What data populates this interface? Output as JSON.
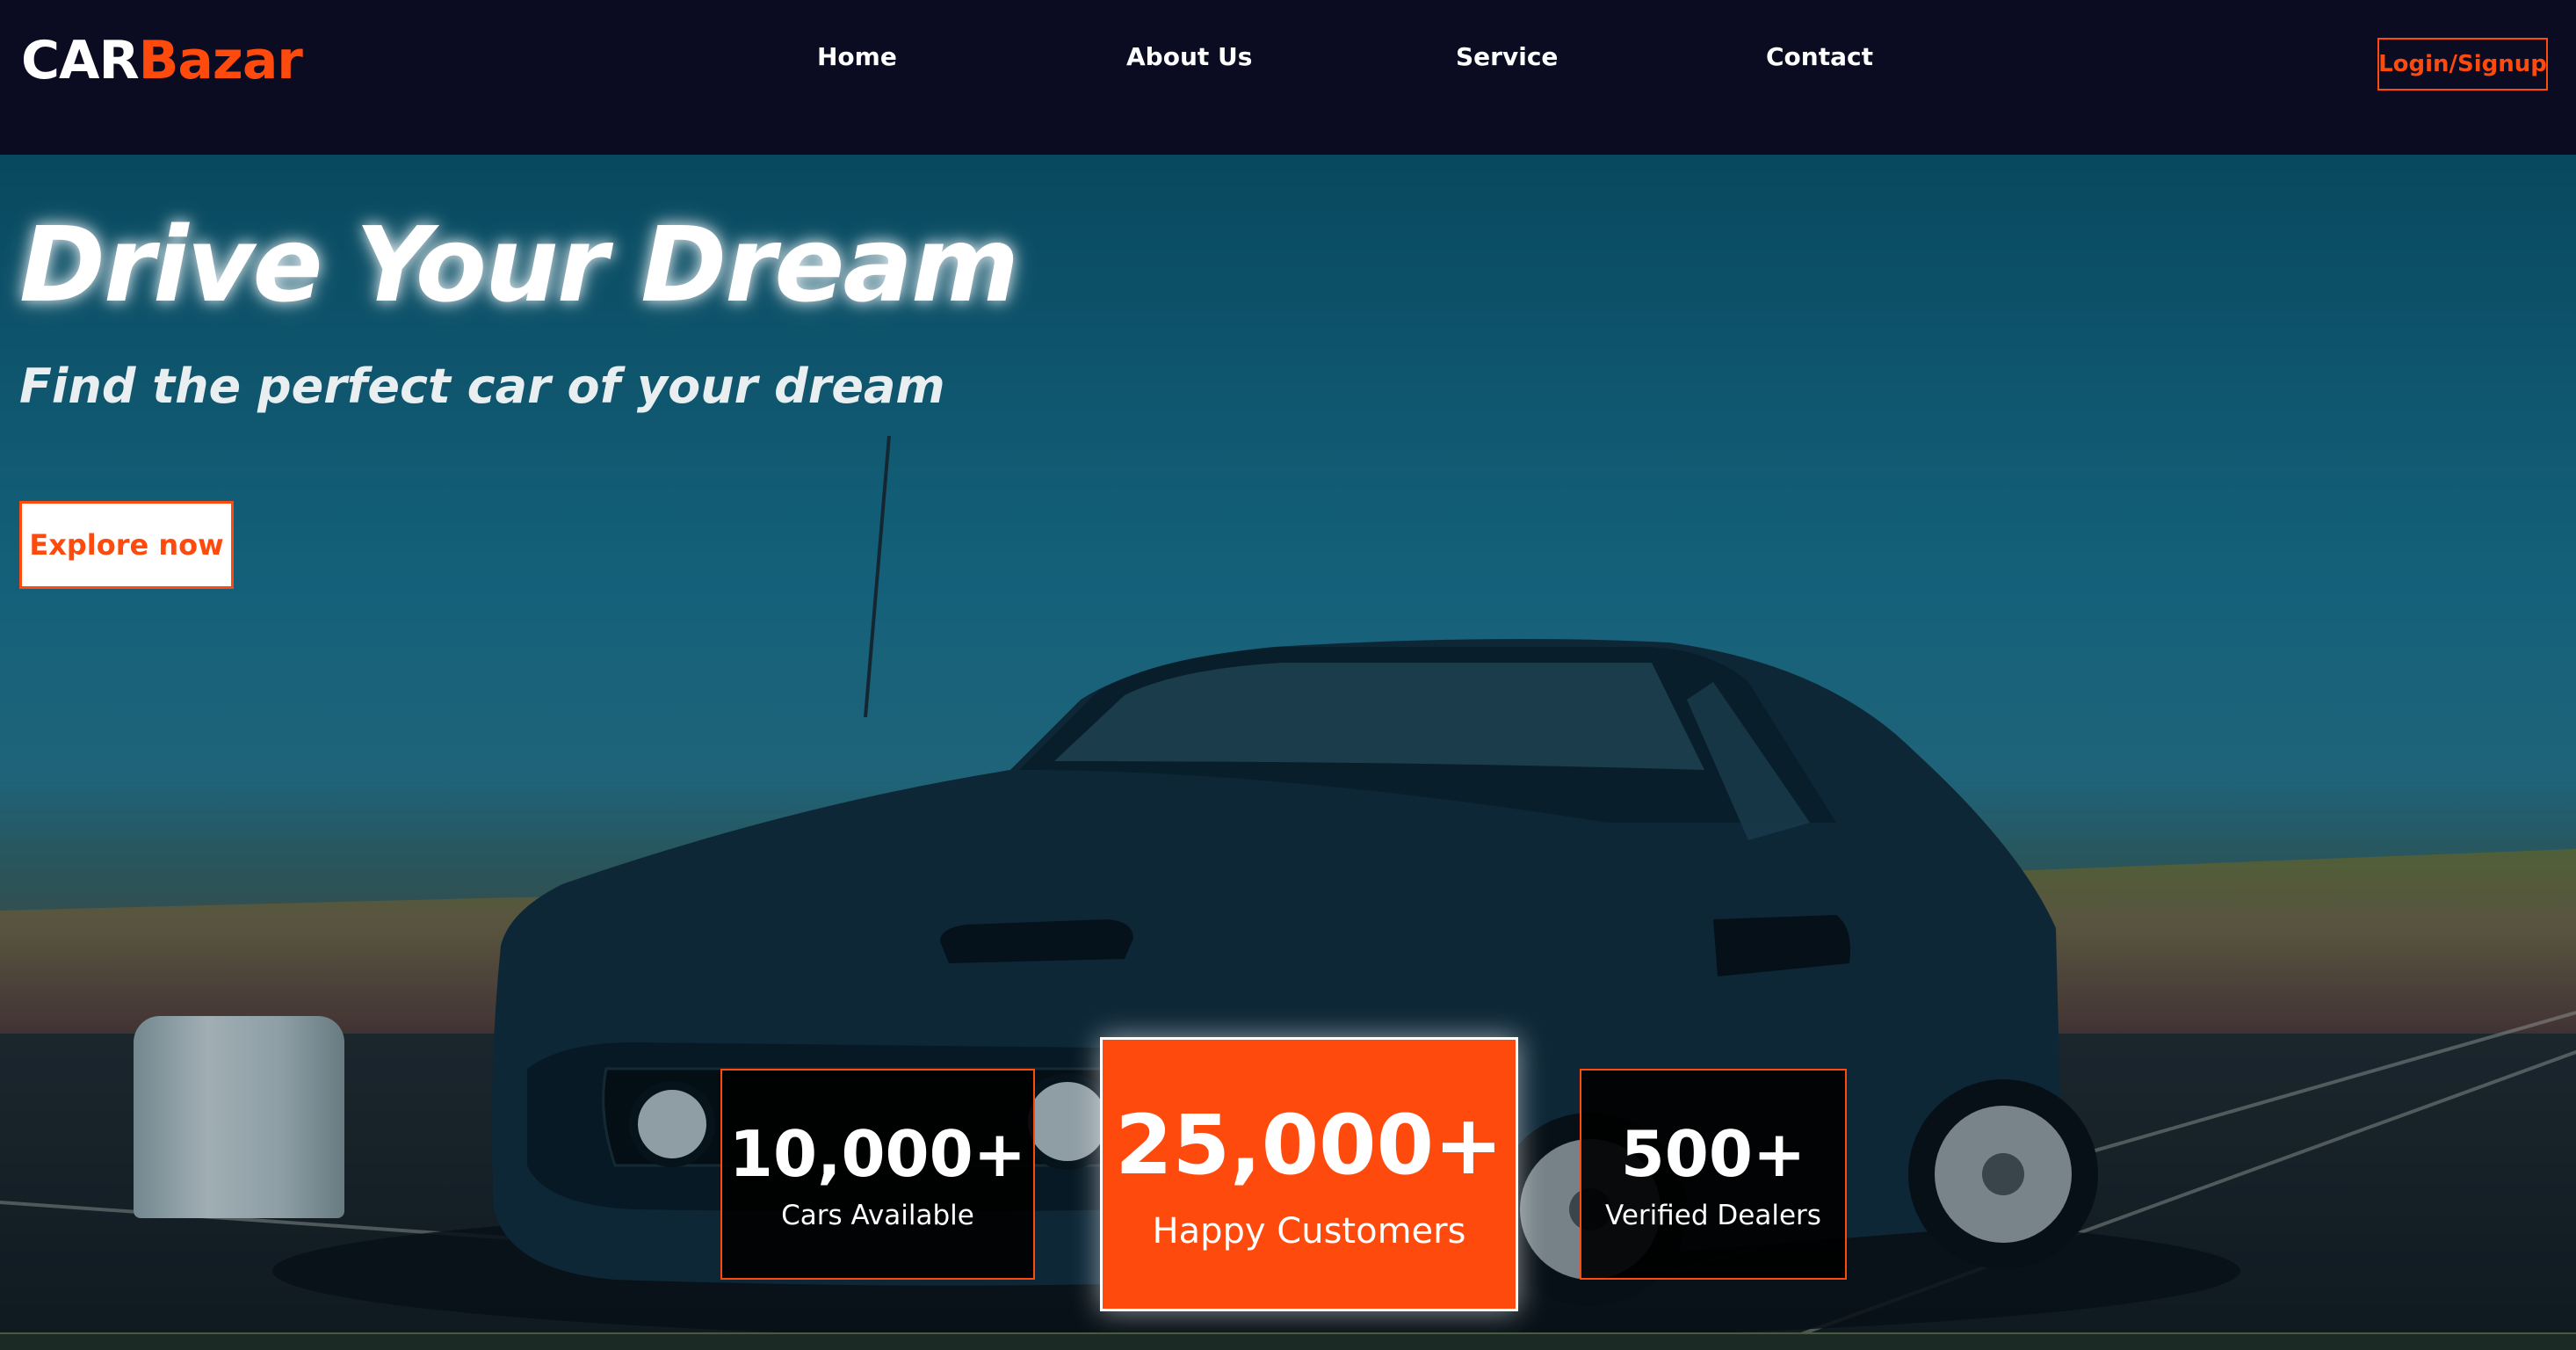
{
  "brand": {
    "logo_primary": "CAR",
    "logo_accent": "Bazar",
    "accent_color": "#ff4a0d",
    "nav_background": "#0b0b22"
  },
  "nav": {
    "links": [
      "Home",
      "About Us",
      "Service",
      "Contact"
    ],
    "login_label": "Login/Signup"
  },
  "hero": {
    "title": "Drive Your Dream",
    "subtitle": "Find the perfect car of your dream",
    "cta_label": "Explore now"
  },
  "stats": [
    {
      "value": "10,000+",
      "label": "Cars Available"
    },
    {
      "value": "25,000+",
      "label": "Happy Customers"
    },
    {
      "value": "500+",
      "label": "Verified Dealers"
    }
  ]
}
